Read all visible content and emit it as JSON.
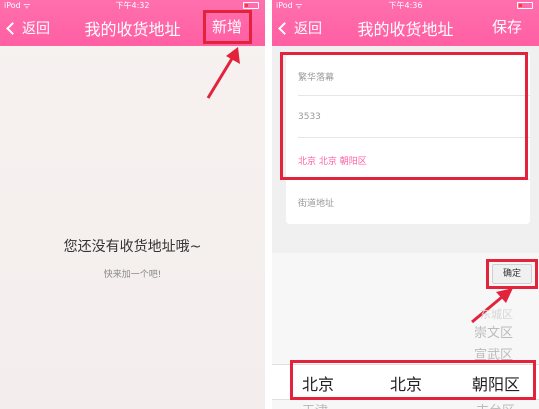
{
  "left": {
    "status": {
      "carrier": "iPod ᯤ",
      "time": "下午4:32"
    },
    "nav": {
      "back_label": "返回",
      "title": "我的收货地址",
      "action_label": "新增"
    },
    "empty": {
      "message": "您还没有收货地址哦~",
      "hint": "快来加一个吧!"
    }
  },
  "right": {
    "status": {
      "carrier": "iPod ᯤ",
      "time": "下午4:36"
    },
    "nav": {
      "back_label": "返回",
      "title": "我的收货地址",
      "action_label": "保存"
    },
    "form": {
      "name_value": "繁华落幕",
      "phone_value": "3533",
      "region_value": "北京 北京 朝阳区",
      "street_placeholder": "街道地址"
    },
    "picker": {
      "confirm_label": "确定",
      "above_rows": [
        "东城区",
        "崇文区",
        "宣武区"
      ],
      "selected": {
        "province": "北京",
        "city": "北京",
        "district": "朝阳区"
      },
      "below_rows": {
        "province": "天津",
        "district": "丰台区"
      }
    }
  },
  "colors": {
    "nav_pink": "#ff6fae",
    "highlight_red": "#e3233b",
    "region_pink": "#ff5fa3"
  }
}
